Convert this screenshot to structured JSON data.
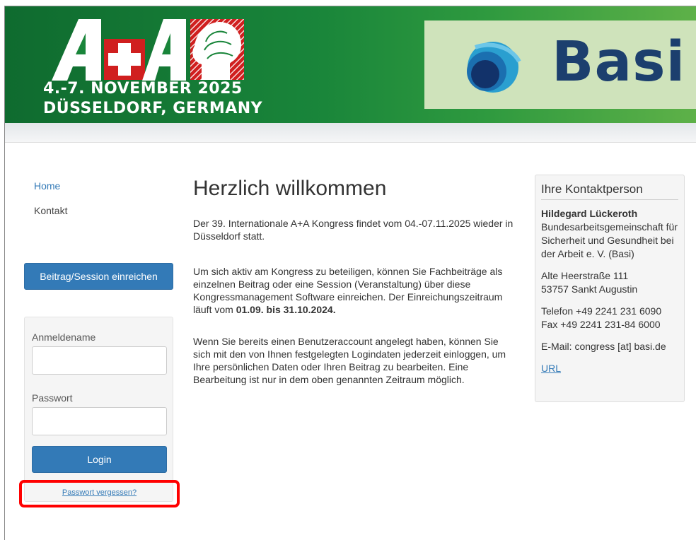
{
  "banner": {
    "event_logo_text": "A+A",
    "date_line": "4.-7. NOVEMBER 2025",
    "location_line": "DÜSSELDORF, GERMANY",
    "partner_logo_text": "Basi",
    "colors": {
      "banner_green": "#19853a",
      "basi_bg": "#cfe3bb",
      "basi_text": "#1c3f6e"
    }
  },
  "nav": {
    "home": "Home",
    "kontakt": "Kontakt"
  },
  "submit_button": "Beitrag/Session einreichen",
  "login": {
    "username_label": "Anmeldename",
    "username_value": "",
    "password_label": "Passwort",
    "password_value": "",
    "login_button": "Login",
    "forgot_link": "Passwort vergessen?"
  },
  "main": {
    "title": "Herzlich willkommen",
    "para1": "Der 39. Internationale A+A Kongress findet vom 04.-07.11.2025 wieder in Düsseldorf statt.",
    "para2_text": "Um sich aktiv am Kongress zu beteiligen, können Sie Fachbeiträge als einzelnen Beitrag oder eine Session (Veranstaltung) über diese Kongressmanagement Software einreichen. Der Einreichungszeitraum läuft vom",
    "para2_bold": "01.09. bis 31.10.2024.",
    "para3": "Wenn Sie bereits einen Benutzeraccount angelegt haben, können Sie sich mit den von Ihnen festgelegten Logindaten jederzeit einloggen, um Ihre persönlichen Daten oder Ihren Beitrag zu bearbeiten. Eine Bearbeitung ist nur in dem oben genannten Zeitraum möglich."
  },
  "contact": {
    "heading": "Ihre Kontaktperson",
    "name": "Hildegard Lückeroth",
    "org": "Bundesarbeitsgemeinschaft für Sicherheit und Gesundheit bei der Arbeit e. V. (Basi)",
    "street": "Alte Heerstraße 111",
    "city": "53757 Sankt Augustin",
    "phone": "Telefon +49 2241 231 6090",
    "fax": "Fax +49 2241 231-84 6000",
    "email": "E-Mail: congress [at] basi.de",
    "url_label": "URL"
  },
  "colors": {
    "accent": "#337ab7",
    "highlight": "#ff0000"
  }
}
